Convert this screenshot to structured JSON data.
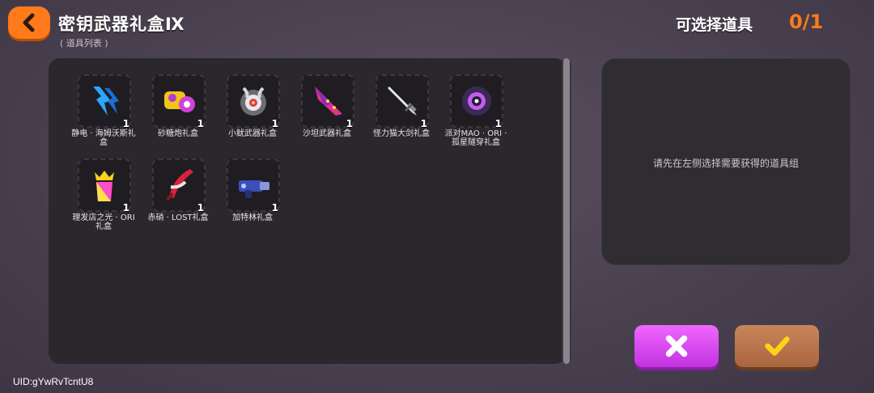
{
  "header": {
    "title": "密钥武器礼盒Ⅸ",
    "subtitle": "( 道具列表 )",
    "select_label": "可选择道具",
    "select_count": "0/1"
  },
  "items": [
    {
      "name": "静电 · 海姆沃斯礼盒",
      "qty": "1",
      "icon": "blue-lightning-weapon-icon"
    },
    {
      "name": "砂糖炮礼盒",
      "qty": "1",
      "icon": "candy-cannon-icon"
    },
    {
      "name": "小鱿武器礼盒",
      "qty": "1",
      "icon": "squid-weapon-icon"
    },
    {
      "name": "沙坦武器礼盒",
      "qty": "1",
      "icon": "pink-blade-icon"
    },
    {
      "name": "怪力猫大剑礼盒",
      "qty": "1",
      "icon": "greatsword-icon"
    },
    {
      "name": "派对MAO · ORI · 孤星隧穿礼盒",
      "qty": "1",
      "icon": "star-orb-icon"
    },
    {
      "name": "理发店之光 · ORI 礼盒",
      "qty": "1",
      "icon": "crown-gem-icon"
    },
    {
      "name": "赤硝 · LOST礼盒",
      "qty": "1",
      "icon": "red-scythe-icon"
    },
    {
      "name": "加特林礼盒",
      "qty": "1",
      "icon": "gatling-icon"
    }
  ],
  "right_panel": {
    "hint": "请先在左侧选择需要获得的道具组"
  },
  "footer": {
    "uid": "UID:gYwRvTcntU8"
  },
  "colors": {
    "accent": "#ff7a1a",
    "cancel": "#d84cf0",
    "confirm": "#b87048"
  }
}
